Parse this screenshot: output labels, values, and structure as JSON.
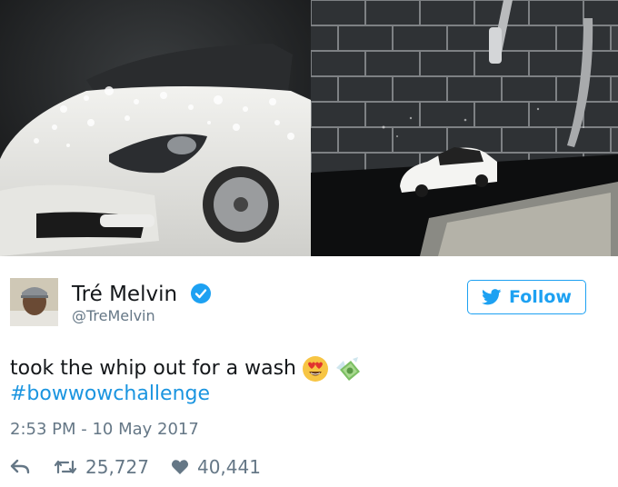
{
  "media": {
    "left_image": "white-sports-car-with-water-drops",
    "right_image": "toy-car-on-kitchen-counter"
  },
  "user": {
    "display_name": "Tré Melvin",
    "handle": "@TreMelvin",
    "verified": true
  },
  "follow_button": {
    "label": "Follow"
  },
  "tweet": {
    "text": "took the whip out for a wash",
    "emojis": [
      "heart-eyes-emoji",
      "money-with-wings-emoji"
    ],
    "hashtag": "#bowwowchallenge",
    "timestamp": "2:53 PM - 10 May 2017"
  },
  "stats": {
    "retweets": "25,727",
    "likes": "40,441"
  },
  "colors": {
    "accent": "#1da1f2",
    "hashtag": "#1b95e0",
    "secondary_text": "#657786",
    "primary_text": "#14171a"
  }
}
